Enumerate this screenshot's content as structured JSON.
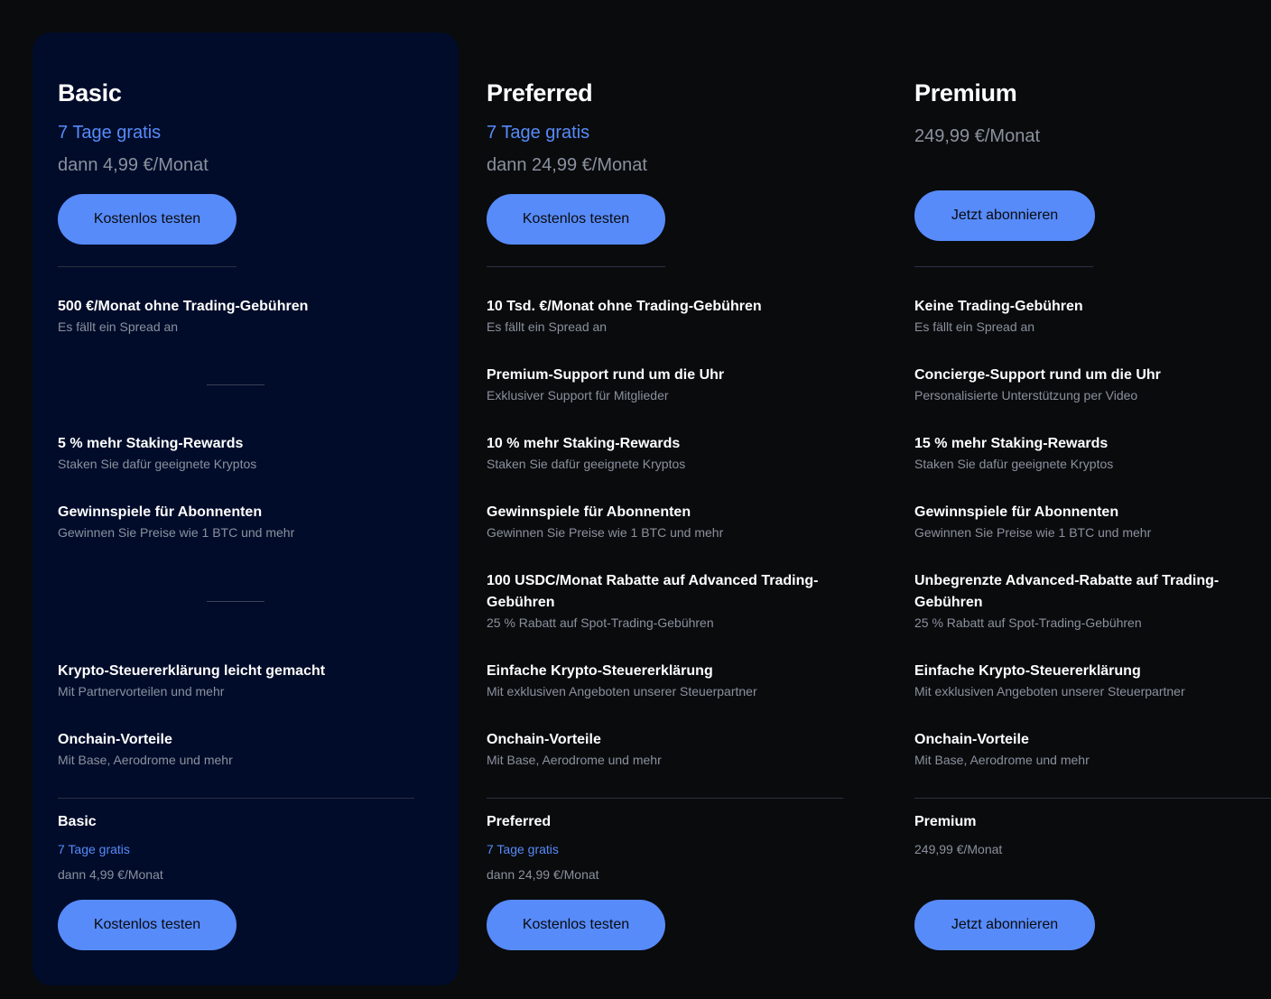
{
  "plans": [
    {
      "name": "Basic",
      "trial": "7 Tage gratis",
      "price": "dann 4,99 €/Monat",
      "cta": "Kostenlos testen",
      "features": [
        {
          "title": "500 €/Monat ohne Trading-Gebühren",
          "sub": "Es fällt ein Spread an"
        },
        {
          "title": "5 % mehr Staking-Rewards",
          "sub": "Staken Sie dafür geeignete Kryptos"
        },
        {
          "title": "Gewinnspiele für Abonnenten",
          "sub": "Gewinnen Sie Preise wie 1 BTC und mehr"
        },
        {
          "title": "Krypto-Steuererklärung leicht gemacht",
          "sub": "Mit Partnervorteilen und mehr"
        },
        {
          "title": "Onchain-Vorteile",
          "sub": "Mit Base, Aerodrome und mehr"
        }
      ],
      "footer": {
        "name": "Basic",
        "trial": "7 Tage gratis",
        "price": "dann 4,99 €/Monat",
        "cta": "Kostenlos testen"
      }
    },
    {
      "name": "Preferred",
      "trial": "7 Tage gratis",
      "price": "dann 24,99 €/Monat",
      "cta": "Kostenlos testen",
      "features": [
        {
          "title": "10 Tsd. €/Monat ohne Trading-Gebühren",
          "sub": "Es fällt ein Spread an"
        },
        {
          "title": "Premium-Support rund um die Uhr",
          "sub": "Exklusiver Support für Mitglieder"
        },
        {
          "title": "10 % mehr Staking-Rewards",
          "sub": "Staken Sie dafür geeignete Kryptos"
        },
        {
          "title": "Gewinnspiele für Abonnenten",
          "sub": "Gewinnen Sie Preise wie 1 BTC und mehr"
        },
        {
          "title": "100 USDC/Monat Rabatte auf Advanced Trading-Gebühren",
          "sub": "25 % Rabatt auf Spot-Trading-Gebühren"
        },
        {
          "title": "Einfache Krypto-Steuererklärung",
          "sub": "Mit exklusiven Angeboten unserer Steuerpartner"
        },
        {
          "title": "Onchain-Vorteile",
          "sub": "Mit Base, Aerodrome und mehr"
        }
      ],
      "footer": {
        "name": "Preferred",
        "trial": "7 Tage gratis",
        "price": "dann 24,99 €/Monat",
        "cta": "Kostenlos testen"
      }
    },
    {
      "name": "Premium",
      "price": "249,99 €/Monat",
      "cta": "Jetzt abonnieren",
      "features": [
        {
          "title": "Keine Trading-Gebühren",
          "sub": "Es fällt ein Spread an"
        },
        {
          "title": "Concierge-Support rund um die Uhr",
          "sub": "Personalisierte Unterstützung per Video"
        },
        {
          "title": "15 % mehr Staking-Rewards",
          "sub": "Staken Sie dafür geeignete Kryptos"
        },
        {
          "title": "Gewinnspiele für Abonnenten",
          "sub": "Gewinnen Sie Preise wie 1 BTC und mehr"
        },
        {
          "title": "Unbegrenzte Advanced-Rabatte auf Trading-Gebühren",
          "sub": "25 % Rabatt auf Spot-Trading-Gebühren"
        },
        {
          "title": "Einfache Krypto-Steuererklärung",
          "sub": "Mit exklusiven Angeboten unserer Steuerpartner"
        },
        {
          "title": "Onchain-Vorteile",
          "sub": "Mit Base, Aerodrome und mehr"
        }
      ],
      "footer": {
        "name": "Premium",
        "price": "249,99 €/Monat",
        "cta": "Jetzt abonnieren"
      }
    }
  ],
  "colors": {
    "page_background": "#0a0b0d",
    "highlight_card": "#010c2a",
    "accent": "#578bfa",
    "muted_text": "#8a919e"
  }
}
